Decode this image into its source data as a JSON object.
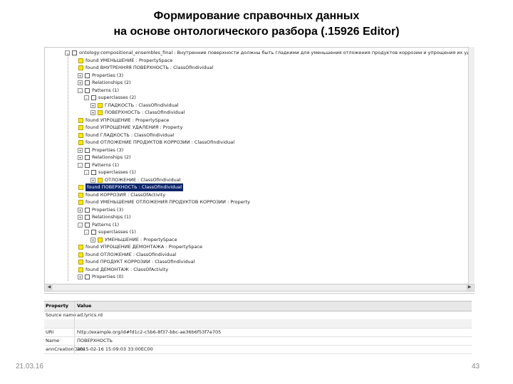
{
  "slide": {
    "title_line1": "Формирование справочных данных",
    "title_line2": "на основе онтологического разбора (.15926 Editor)",
    "date": "21.03.16",
    "page": "43"
  },
  "tree": [
    {
      "text": "ontology:compositional_ensembles_final : Внутренние поверхности должны быть гладкими для уменьшения отложения продуктов коррозии и упрощения их удаления",
      "indent": 0,
      "exp": "-",
      "icon": "white"
    },
    {
      "text": "found УМЕНЬШЕНИЕ : PropertySpace",
      "indent": 1,
      "exp": "",
      "icon": "yellow"
    },
    {
      "text": "found ВНУТРЕННЯЯ ПОВЕРХНОСТЬ : ClassOfIndividual",
      "indent": 1,
      "exp": "",
      "icon": "yellow"
    },
    {
      "text": "Properties (3)",
      "indent": 2,
      "exp": "+",
      "icon": "white"
    },
    {
      "text": "Relationships (2)",
      "indent": 2,
      "exp": "+",
      "icon": "white"
    },
    {
      "text": "Patterns (1)",
      "indent": 2,
      "exp": "-",
      "icon": "white"
    },
    {
      "text": "superclasses (2)",
      "indent": 3,
      "exp": "-",
      "icon": "white"
    },
    {
      "text": "ГЛАДКОСТЬ : ClassOfIndividual",
      "indent": 4,
      "exp": "+",
      "icon": "yellow"
    },
    {
      "text": "ПОВЕРХНОСТЬ : ClassOfIndividual",
      "indent": 4,
      "exp": "+",
      "icon": "yellow"
    },
    {
      "text": "found УПРОЩЕНИЕ : PropertySpace",
      "indent": 1,
      "exp": "",
      "icon": "yellow"
    },
    {
      "text": "found УПРОЩЕНИЕ УДАЛЕНИЯ : Property",
      "indent": 1,
      "exp": "",
      "icon": "yellow"
    },
    {
      "text": "found ГЛАДКОСТЬ : ClassOfIndividual",
      "indent": 1,
      "exp": "",
      "icon": "yellow"
    },
    {
      "text": "found ОТЛОЖЕНИЕ ПРОДУКТОВ КОРРОЗИИ : ClassOfIndividual",
      "indent": 1,
      "exp": "",
      "icon": "yellow"
    },
    {
      "text": "Properties (3)",
      "indent": 2,
      "exp": "+",
      "icon": "white"
    },
    {
      "text": "Relationships (2)",
      "indent": 2,
      "exp": "+",
      "icon": "white"
    },
    {
      "text": "Patterns (1)",
      "indent": 2,
      "exp": "-",
      "icon": "white"
    },
    {
      "text": "superclasses (1)",
      "indent": 3,
      "exp": "-",
      "icon": "white"
    },
    {
      "text": "ОТЛОЖЕНИЕ : ClassOfIndividual",
      "indent": 4,
      "exp": "+",
      "icon": "yellow"
    },
    {
      "text": "found ПОВЕРХНОСТЬ : ClassOfIndividual",
      "indent": 1,
      "exp": "",
      "icon": "yellow",
      "selected": true
    },
    {
      "text": "found КОРРОЗИЯ : ClassOfActivity",
      "indent": 1,
      "exp": "",
      "icon": "yellow"
    },
    {
      "text": "found УМЕНЬШЕНИЕ ОТЛОЖЕНИЯ ПРОДУКТОВ КОРРОЗИИ : Property",
      "indent": 1,
      "exp": "",
      "icon": "yellow"
    },
    {
      "text": "Properties (3)",
      "indent": 2,
      "exp": "+",
      "icon": "white"
    },
    {
      "text": "Relationships (1)",
      "indent": 2,
      "exp": "+",
      "icon": "white"
    },
    {
      "text": "Patterns (1)",
      "indent": 2,
      "exp": "-",
      "icon": "white"
    },
    {
      "text": "superclasses (1)",
      "indent": 3,
      "exp": "-",
      "icon": "white"
    },
    {
      "text": "УМЕНЬШЕНИЕ : PropertySpace",
      "indent": 4,
      "exp": "+",
      "icon": "yellow"
    },
    {
      "text": "found УПРОЩЕНИЕ ДЕМОНТАЖА : PropertySpace",
      "indent": 1,
      "exp": "",
      "icon": "yellow"
    },
    {
      "text": "found ОТЛОЖЕНИЕ : ClassOfIndividual",
      "indent": 1,
      "exp": "",
      "icon": "yellow"
    },
    {
      "text": "found ПРОДУКТ КОРРОЗИИ : ClassOfIndividual",
      "indent": 1,
      "exp": "",
      "icon": "yellow"
    },
    {
      "text": "found ДЕМОНТАЖ : ClassOfActivity",
      "indent": 1,
      "exp": "",
      "icon": "yellow"
    },
    {
      "text": "Properties (0)",
      "indent": 2,
      "exp": "+",
      "icon": "white"
    }
  ],
  "properties": {
    "header_col1": "Property",
    "header_col2": "Value",
    "rows": [
      {
        "name": "Source name",
        "value": "ad.lyrics.rd",
        "gap": false
      },
      {
        "name": "",
        "value": "",
        "gap": true
      },
      {
        "name": "URI",
        "value": "http://example.org/id#fd1c2-c5b6-8f37-bbc-ae36b6f53f7e705",
        "gap": false
      },
      {
        "name": "Name",
        "value": "ПОВЕРХНОСТЬ",
        "gap": false
      },
      {
        "name": "annCreationDate",
        "value": "2015-02-16 15:09:03 33:00EC00",
        "gap": false
      }
    ]
  }
}
